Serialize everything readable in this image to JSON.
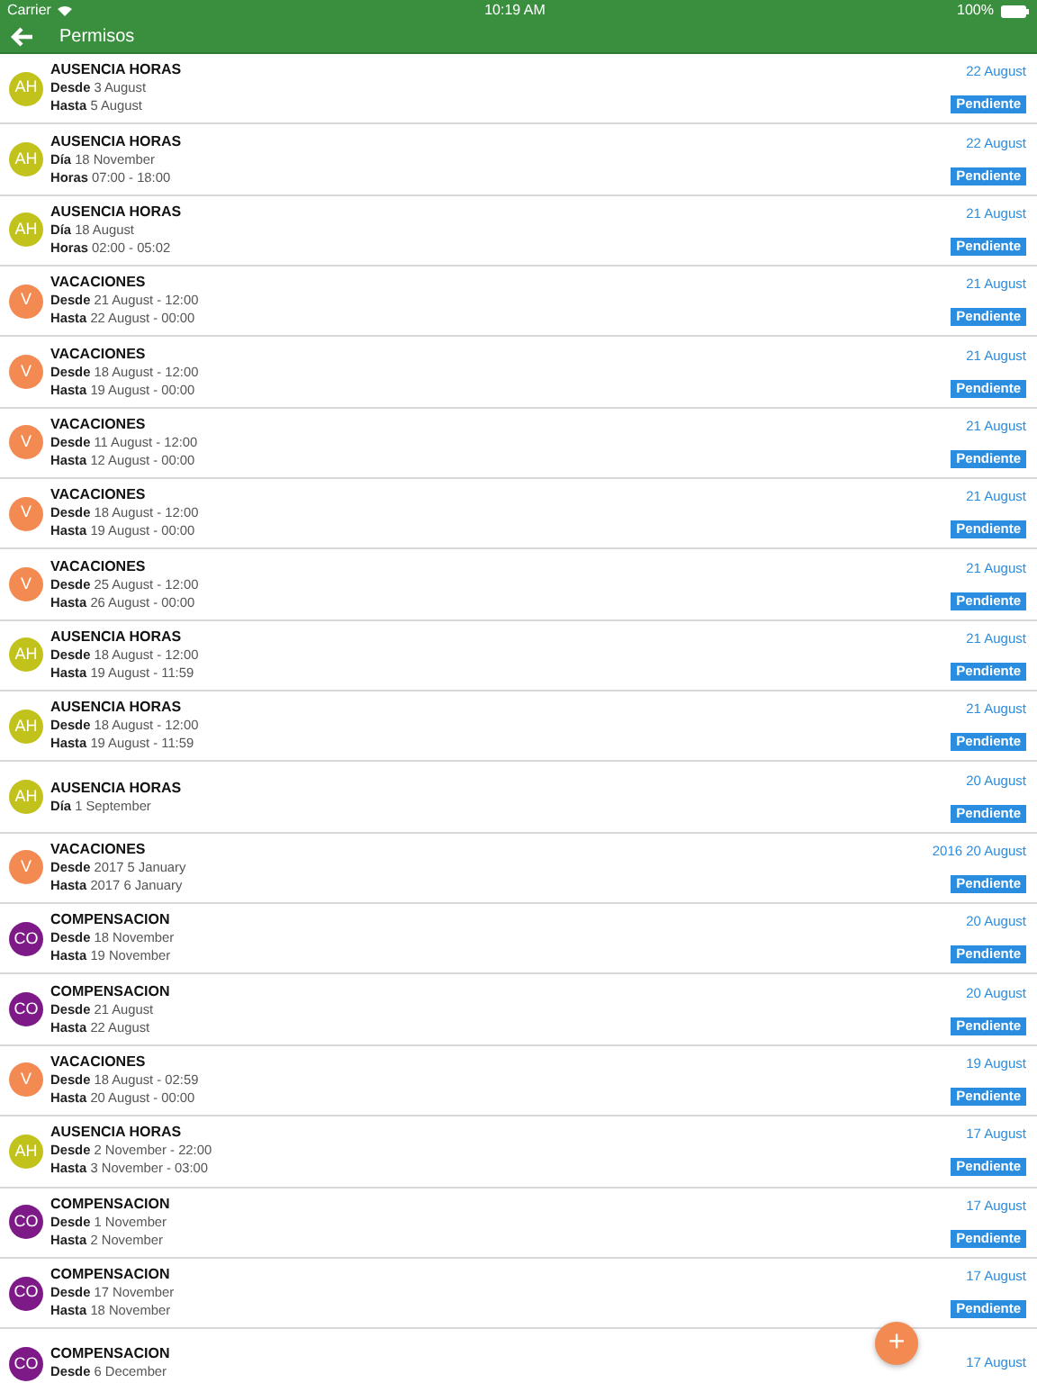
{
  "status_bar": {
    "carrier": "Carrier",
    "time": "10:19 AM",
    "battery": "100%"
  },
  "header": {
    "title": "Permisos"
  },
  "items": [
    {
      "initials": "AH",
      "color": "#c2c21c",
      "title": "AUSENCIA HORAS",
      "lines": [
        {
          "label": "Desde",
          "value": "3 August"
        },
        {
          "label": "Hasta",
          "value": "5 August"
        }
      ],
      "date": "22 August",
      "status": "Pendiente"
    },
    {
      "initials": "AH",
      "color": "#c2c21c",
      "title": "AUSENCIA HORAS",
      "lines": [
        {
          "label": "Día",
          "value": "18 November"
        },
        {
          "label": "Horas",
          "value": "07:00 - 18:00"
        }
      ],
      "date": "22 August",
      "status": "Pendiente"
    },
    {
      "initials": "AH",
      "color": "#c2c21c",
      "title": "AUSENCIA HORAS",
      "lines": [
        {
          "label": "Día",
          "value": "18 August"
        },
        {
          "label": "Horas",
          "value": "02:00 - 05:02"
        }
      ],
      "date": "21 August",
      "status": "Pendiente"
    },
    {
      "initials": "V",
      "color": "#f28a52",
      "title": "VACACIONES",
      "lines": [
        {
          "label": "Desde",
          "value": "21 August - 12:00"
        },
        {
          "label": "Hasta",
          "value": "22 August - 00:00"
        }
      ],
      "date": "21 August",
      "status": "Pendiente"
    },
    {
      "initials": "V",
      "color": "#f28a52",
      "title": "VACACIONES",
      "lines": [
        {
          "label": "Desde",
          "value": "18 August - 12:00"
        },
        {
          "label": "Hasta",
          "value": "19 August - 00:00"
        }
      ],
      "date": "21 August",
      "status": "Pendiente"
    },
    {
      "initials": "V",
      "color": "#f28a52",
      "title": "VACACIONES",
      "lines": [
        {
          "label": "Desde",
          "value": "11 August - 12:00"
        },
        {
          "label": "Hasta",
          "value": "12 August - 00:00"
        }
      ],
      "date": "21 August",
      "status": "Pendiente"
    },
    {
      "initials": "V",
      "color": "#f28a52",
      "title": "VACACIONES",
      "lines": [
        {
          "label": "Desde",
          "value": "18 August - 12:00"
        },
        {
          "label": "Hasta",
          "value": "19 August - 00:00"
        }
      ],
      "date": "21 August",
      "status": "Pendiente"
    },
    {
      "initials": "V",
      "color": "#f28a52",
      "title": "VACACIONES",
      "lines": [
        {
          "label": "Desde",
          "value": "25 August - 12:00"
        },
        {
          "label": "Hasta",
          "value": "26 August - 00:00"
        }
      ],
      "date": "21 August",
      "status": "Pendiente"
    },
    {
      "initials": "AH",
      "color": "#c2c21c",
      "title": "AUSENCIA HORAS",
      "lines": [
        {
          "label": "Desde",
          "value": "18 August - 12:00"
        },
        {
          "label": "Hasta",
          "value": "19 August - 11:59"
        }
      ],
      "date": "21 August",
      "status": "Pendiente"
    },
    {
      "initials": "AH",
      "color": "#c2c21c",
      "title": "AUSENCIA HORAS",
      "lines": [
        {
          "label": "Desde",
          "value": "18 August - 12:00"
        },
        {
          "label": "Hasta",
          "value": "19 August - 11:59"
        }
      ],
      "date": "21 August",
      "status": "Pendiente"
    },
    {
      "initials": "AH",
      "color": "#c2c21c",
      "title": "AUSENCIA HORAS",
      "lines": [
        {
          "label": "Día",
          "value": "1 September"
        }
      ],
      "date": "20 August",
      "status": "Pendiente"
    },
    {
      "initials": "V",
      "color": "#f28a52",
      "title": "VACACIONES",
      "lines": [
        {
          "label": "Desde",
          "value": "2017 5 January"
        },
        {
          "label": "Hasta",
          "value": "2017 6 January"
        }
      ],
      "date": "2016 20 August",
      "status": "Pendiente"
    },
    {
      "initials": "CO",
      "color": "#7d1a87",
      "title": "COMPENSACION",
      "lines": [
        {
          "label": "Desde",
          "value": "18 November"
        },
        {
          "label": "Hasta",
          "value": "19 November"
        }
      ],
      "date": "20 August",
      "status": "Pendiente"
    },
    {
      "initials": "CO",
      "color": "#7d1a87",
      "title": "COMPENSACION",
      "lines": [
        {
          "label": "Desde",
          "value": "21 August"
        },
        {
          "label": "Hasta",
          "value": "22 August"
        }
      ],
      "date": "20 August",
      "status": "Pendiente"
    },
    {
      "initials": "V",
      "color": "#f28a52",
      "title": "VACACIONES",
      "lines": [
        {
          "label": "Desde",
          "value": "18 August - 02:59"
        },
        {
          "label": "Hasta",
          "value": "20 August - 00:00"
        }
      ],
      "date": "19 August",
      "status": "Pendiente"
    },
    {
      "initials": "AH",
      "color": "#c2c21c",
      "title": "AUSENCIA HORAS",
      "lines": [
        {
          "label": "Desde",
          "value": "2 November - 22:00"
        },
        {
          "label": "Hasta",
          "value": "3 November - 03:00"
        }
      ],
      "date": "17 August",
      "status": "Pendiente"
    },
    {
      "initials": "CO",
      "color": "#7d1a87",
      "title": "COMPENSACION",
      "lines": [
        {
          "label": "Desde",
          "value": "1 November"
        },
        {
          "label": "Hasta",
          "value": "2 November"
        }
      ],
      "date": "17 August",
      "status": "Pendiente"
    },
    {
      "initials": "CO",
      "color": "#7d1a87",
      "title": "COMPENSACION",
      "lines": [
        {
          "label": "Desde",
          "value": "17 November"
        },
        {
          "label": "Hasta",
          "value": "18 November"
        }
      ],
      "date": "17 August",
      "status": "Pendiente"
    },
    {
      "initials": "CO",
      "color": "#7d1a87",
      "title": "COMPENSACION",
      "lines": [
        {
          "label": "Desde",
          "value": "6 December"
        }
      ],
      "date": "17 August"
    }
  ],
  "fab": {
    "label": "+"
  }
}
